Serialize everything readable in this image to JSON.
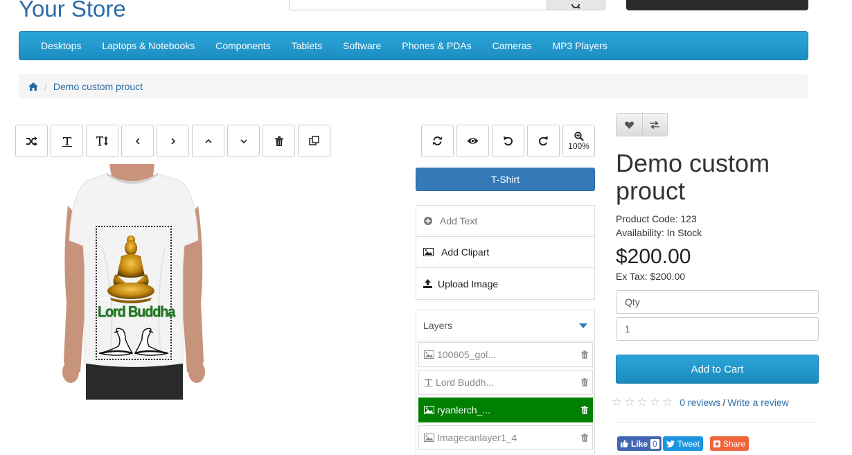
{
  "header": {
    "store_name": "Your Store"
  },
  "nav": {
    "items": [
      "Desktops",
      "Laptops & Notebooks",
      "Components",
      "Tablets",
      "Software",
      "Phones & PDAs",
      "Cameras",
      "MP3 Players"
    ]
  },
  "breadcrumb": {
    "current": "Demo custom prouct"
  },
  "designer": {
    "zoom": "100%",
    "design_text": "Lord Buddha",
    "product_button": "T-Shirt",
    "actions": [
      "Add Text",
      "Add Clipart",
      "Upload Image"
    ],
    "layers_title": "Layers",
    "layers": [
      {
        "name": "100605_gol...",
        "type": "image",
        "active": false
      },
      {
        "name": "Lord Buddh...",
        "type": "text",
        "active": false
      },
      {
        "name": "ryanlerch_...",
        "type": "image",
        "active": true
      },
      {
        "name": "Imagecanlayer1_4",
        "type": "image",
        "active": false
      }
    ],
    "active_color": "#008000"
  },
  "product": {
    "title": "Demo custom prouct",
    "code_line": "Product Code: 123",
    "availability_line": "Availability: In Stock",
    "price": "$200.00",
    "ex_tax": "Ex Tax: $200.00",
    "qty_label": "Qty",
    "qty_value": "1",
    "add_to_cart": "Add to Cart",
    "rating": 0,
    "reviews_link": "0 reviews",
    "write_review": "Write a review"
  },
  "social": {
    "like": "Like",
    "like_count": "0",
    "tweet": "Tweet",
    "share": "Share"
  },
  "colors": {
    "brand_link": "#2b6ca8",
    "navbar": "#229ad0",
    "primary_button": "#337ab7"
  }
}
